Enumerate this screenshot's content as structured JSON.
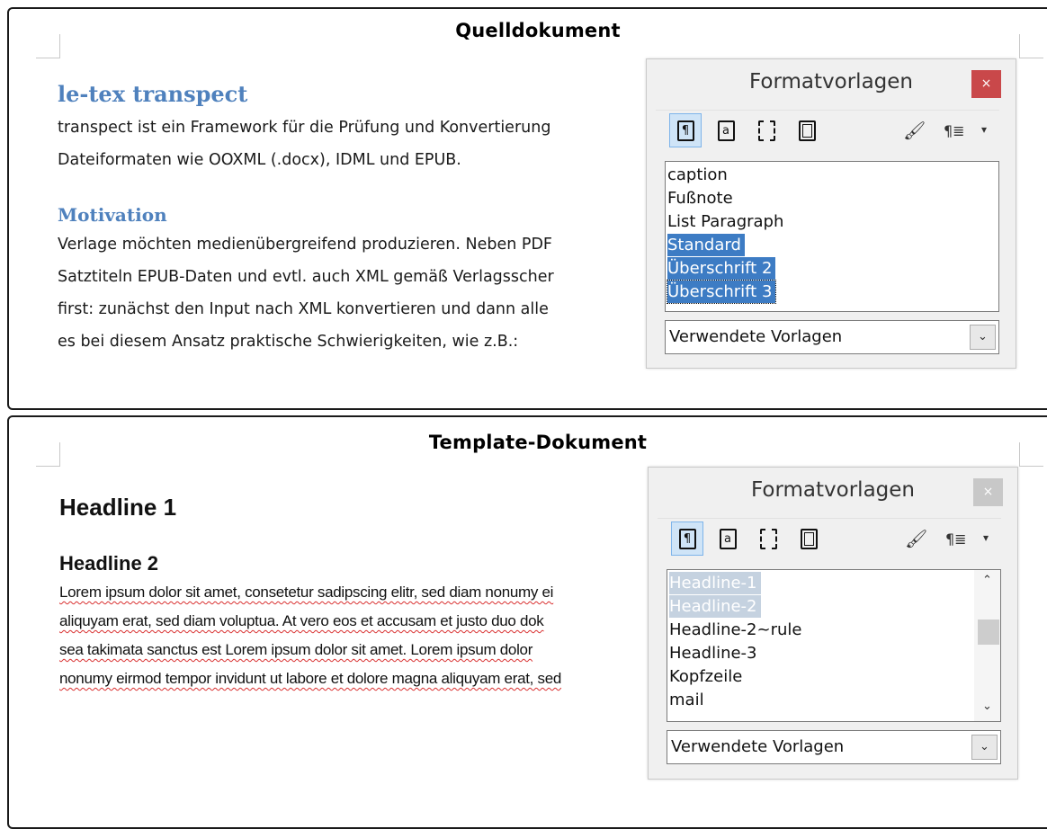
{
  "source_panel": {
    "title": "Quelldokument",
    "heading_1": "le-tex transpect",
    "paragraph_1": [
      "transpect ist ein Framework für die Prüfung und Konvertierung",
      "Dateiformaten wie OOXML (.docx), IDML und EPUB."
    ],
    "heading_2": "Motivation",
    "paragraph_2": [
      "Verlage möchten medienübergreifend produzieren. Neben PDF",
      "Satztiteln EPUB-Daten und evtl. auch XML gemäß Verlagsscher",
      "first: zunächst den Input nach XML konvertieren und dann alle",
      "es bei diesem Ansatz praktische Schwierigkeiten, wie z.B.:"
    ],
    "dialog": {
      "title": "Formatvorlagen",
      "close_label": "×",
      "tools": [
        "¶",
        "a",
        "",
        "",
        ""
      ],
      "fill_label": "🖌",
      "para_label": "¶≣",
      "dropdown_label": "▾",
      "items": [
        "caption",
        "Fußnote",
        "List Paragraph",
        "Standard",
        "Überschrift 2",
        "Überschrift 3"
      ],
      "filter": "Verwendete Vorlagen",
      "filter_arrow": "⌄"
    }
  },
  "template_panel": {
    "title": "Template-Dokument",
    "headline_1": "Headline 1",
    "headline_2": "Headline 2",
    "lorem": [
      "Lorem ipsum dolor sit amet, consetetur sadipscing elitr, sed diam nonumy ei",
      "aliquyam erat, sed diam voluptua. At vero eos et accusam et justo duo dok",
      "sea takimata sanctus est Lorem ipsum dolor sit amet. Lorem ipsum dolor",
      "nonumy eirmod tempor invidunt ut labore et dolore magna aliquyam erat, sed"
    ],
    "dialog": {
      "title": "Formatvorlagen",
      "close_label": "×",
      "tools": [
        "¶",
        "a",
        "",
        "",
        ""
      ],
      "fill_label": "🖌",
      "para_label": "¶≣",
      "dropdown_label": "▾",
      "items": [
        "Headline-1",
        "Headline-2",
        "Headline-2~rule",
        "Headline-3",
        "Kopfzeile",
        "mail"
      ],
      "scroll_up": "⌃",
      "scroll_down": "⌄",
      "filter": "Verwendete Vorlagen",
      "filter_arrow": "⌄"
    }
  }
}
